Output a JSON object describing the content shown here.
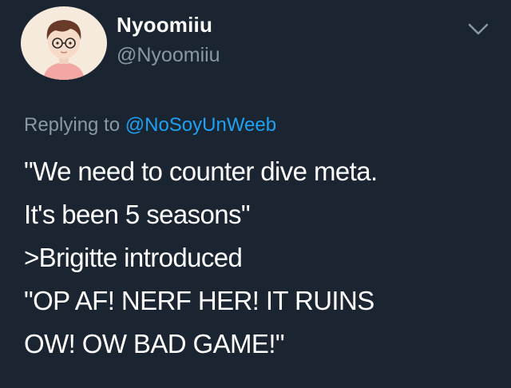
{
  "author": {
    "display_name": "Nyoomiiu",
    "handle": "@Nyoomiiu",
    "avatar_icon": "cartoon-avatar-with-glasses"
  },
  "menu": {
    "icon": "chevron-down-icon"
  },
  "reply": {
    "prefix": "Replying to",
    "target": "@NoSoyUnWeeb"
  },
  "tweet": {
    "lines": [
      "\"We need to counter dive meta.",
      "It's been 5 seasons\"",
      ">Brigitte introduced",
      "\"OP AF! NERF HER! IT RUINS",
      "OW! OW BAD GAME!\""
    ]
  },
  "colors": {
    "background": "#1b2532",
    "secondary_text": "#8899a6",
    "link": "#1da1f2",
    "primary_text": "#ffffff"
  }
}
